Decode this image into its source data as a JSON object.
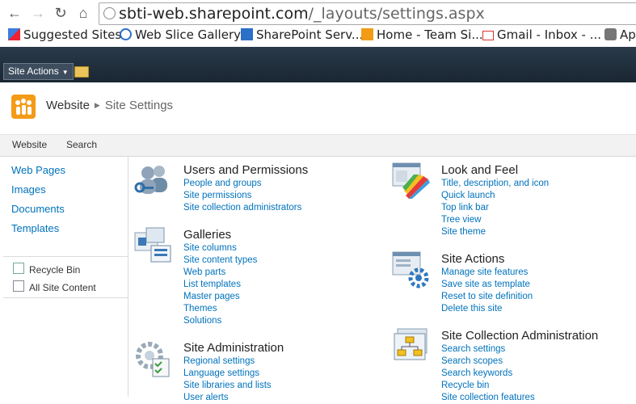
{
  "browser": {
    "url_host": "sbti-web.sharepoint.com",
    "url_path": "/_layouts/settings.aspx",
    "bookmarks": [
      {
        "label": "Suggested Sites",
        "icon": "bookmark-apps-icon"
      },
      {
        "label": "Web Slice Gallery",
        "icon": "ie-icon"
      },
      {
        "label": "SharePoint Serv...",
        "icon": "sharepoint-icon"
      },
      {
        "label": "Home - Team Si...",
        "icon": "team-site-icon"
      },
      {
        "label": "Gmail - Inbox - ...",
        "icon": "gmail-icon"
      },
      {
        "label": "Ap",
        "icon": "apple-icon"
      }
    ]
  },
  "ribbon": {
    "site_actions": "Site Actions"
  },
  "title": {
    "site": "Website",
    "page": "Site Settings"
  },
  "top_links": [
    "Website",
    "Search"
  ],
  "quick_launch": {
    "items": [
      "Web Pages",
      "Images",
      "Documents",
      "Templates"
    ],
    "tools": [
      "Recycle Bin",
      "All Site Content"
    ]
  },
  "sections": {
    "users": {
      "title": "Users and Permissions",
      "links": [
        "People and groups",
        "Site permissions",
        "Site collection administrators"
      ]
    },
    "galleries": {
      "title": "Galleries",
      "links": [
        "Site columns",
        "Site content types",
        "Web parts",
        "List templates",
        "Master pages",
        "Themes",
        "Solutions"
      ]
    },
    "admin": {
      "title": "Site Administration",
      "links": [
        "Regional settings",
        "Language settings",
        "Site libraries and lists",
        "User alerts"
      ]
    },
    "look": {
      "title": "Look and Feel",
      "links": [
        "Title, description, and icon",
        "Quick launch",
        "Top link bar",
        "Tree view",
        "Site theme"
      ]
    },
    "actions": {
      "title": "Site Actions",
      "links": [
        "Manage site features",
        "Save site as template",
        "Reset to site definition",
        "Delete this site"
      ]
    },
    "collection": {
      "title": "Site Collection Administration",
      "links": [
        "Search settings",
        "Search scopes",
        "Search keywords",
        "Recycle bin",
        "Site collection features"
      ]
    }
  }
}
